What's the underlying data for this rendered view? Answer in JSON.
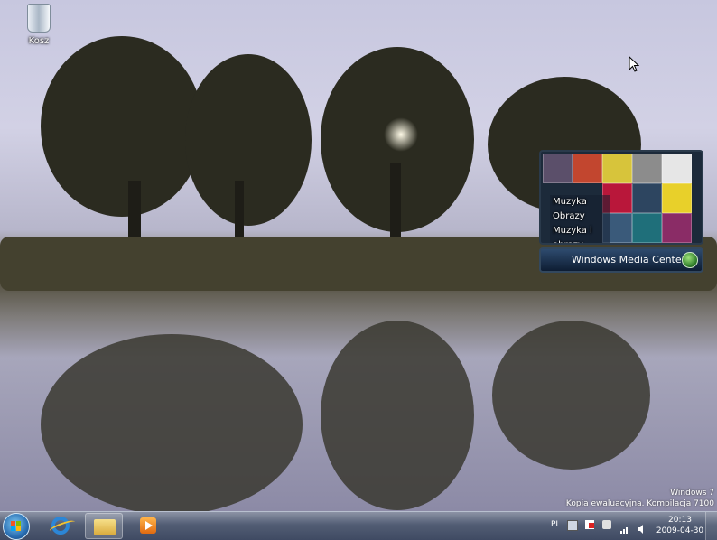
{
  "desktop": {
    "icons": [
      {
        "label": "Kosz",
        "icon": "recycle-bin-icon"
      }
    ]
  },
  "media_center_gadget": {
    "menu": [
      "Muzyka",
      "Obrazy",
      "Muzyka i obrazy"
    ],
    "title": "Windows Media Center"
  },
  "watermark": {
    "line1": "Windows 7",
    "line2": "Kopia ewaluacyjna. Kompilacja 7100"
  },
  "taskbar": {
    "pinned": [
      {
        "name": "internet-explorer",
        "icon": "internet-explorer-icon",
        "active": false
      },
      {
        "name": "windows-explorer",
        "icon": "folder-icon",
        "active": true
      },
      {
        "name": "windows-media-player",
        "icon": "media-player-icon",
        "active": false
      }
    ],
    "language": "PL",
    "tray_icons": [
      "keyboard-icon",
      "action-center-icon",
      "power-icon",
      "network-icon",
      "volume-icon"
    ],
    "clock": {
      "time": "20:13",
      "date": "2009-04-30"
    }
  },
  "colors": {
    "taskbar": "#4a556c",
    "accent": "#2c86d6"
  }
}
